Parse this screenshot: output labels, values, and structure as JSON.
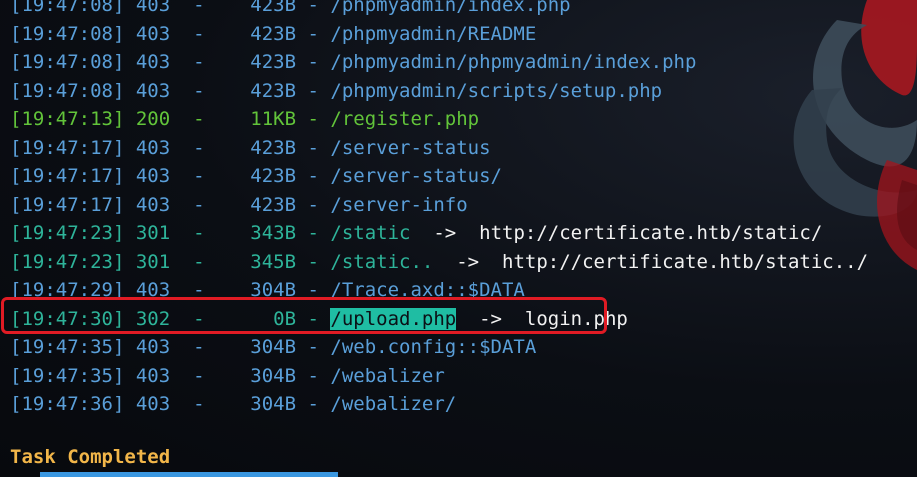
{
  "log_lines": [
    {
      "time": "[19:47:08]",
      "status": "403",
      "sep": " -",
      "size": "423B",
      "path": "/phpmyadmin/index.php",
      "arrow": "",
      "target": "",
      "color": "blue"
    },
    {
      "time": "[19:47:08]",
      "status": "403",
      "sep": " -",
      "size": "423B",
      "path": "/phpmyadmin/README",
      "arrow": "",
      "target": "",
      "color": "blue"
    },
    {
      "time": "[19:47:08]",
      "status": "403",
      "sep": " -",
      "size": "423B",
      "path": "/phpmyadmin/phpmyadmin/index.php",
      "arrow": "",
      "target": "",
      "color": "blue"
    },
    {
      "time": "[19:47:08]",
      "status": "403",
      "sep": " -",
      "size": "423B",
      "path": "/phpmyadmin/scripts/setup.php",
      "arrow": "",
      "target": "",
      "color": "blue"
    },
    {
      "time": "[19:47:13]",
      "status": "200",
      "sep": " -",
      "size": "11KB",
      "path": "/register.php",
      "arrow": "",
      "target": "",
      "color": "green"
    },
    {
      "time": "[19:47:17]",
      "status": "403",
      "sep": " -",
      "size": "423B",
      "path": "/server-status",
      "arrow": "",
      "target": "",
      "color": "blue"
    },
    {
      "time": "[19:47:17]",
      "status": "403",
      "sep": " -",
      "size": "423B",
      "path": "/server-status/",
      "arrow": "",
      "target": "",
      "color": "blue"
    },
    {
      "time": "[19:47:17]",
      "status": "403",
      "sep": " -",
      "size": "423B",
      "path": "/server-info",
      "arrow": "",
      "target": "",
      "color": "blue"
    },
    {
      "time": "[19:47:23]",
      "status": "301",
      "sep": " -",
      "size": "343B",
      "path": "/static",
      "arrow": "->",
      "target": "http://certificate.htb/static/",
      "color": "teal"
    },
    {
      "time": "[19:47:23]",
      "status": "301",
      "sep": " -",
      "size": "345B",
      "path": "/static..",
      "arrow": "->",
      "target": "http://certificate.htb/static../",
      "color": "teal"
    },
    {
      "time": "[19:47:29]",
      "status": "403",
      "sep": " -",
      "size": "304B",
      "path": "/Trace.axd::$DATA",
      "arrow": "",
      "target": "",
      "color": "blue"
    },
    {
      "time": "[19:47:30]",
      "status": "302",
      "sep": " -",
      "size": "0B",
      "path": "/upload.php",
      "arrow": "->",
      "target": "login.php",
      "color": "teal",
      "highlight_path": true
    },
    {
      "time": "[19:47:35]",
      "status": "403",
      "sep": " -",
      "size": "304B",
      "path": "/web.config::$DATA",
      "arrow": "",
      "target": "",
      "color": "blue"
    },
    {
      "time": "[19:47:35]",
      "status": "403",
      "sep": " -",
      "size": "304B",
      "path": "/webalizer",
      "arrow": "",
      "target": "",
      "color": "blue"
    },
    {
      "time": "[19:47:36]",
      "status": "403",
      "sep": " -",
      "size": "304B",
      "path": "/webalizer/",
      "arrow": "",
      "target": "",
      "color": "blue"
    }
  ],
  "task_status": "Task Completed",
  "progress_fraction": 1.0,
  "colors": {
    "blue": "#5a9fd9",
    "green": "#62c43a",
    "teal": "#2eb49a",
    "highlight_bg": "#1fbda3",
    "box_red": "#e01b24",
    "task_yellow": "#f2b649",
    "progress_blue": "#3a97e0"
  }
}
